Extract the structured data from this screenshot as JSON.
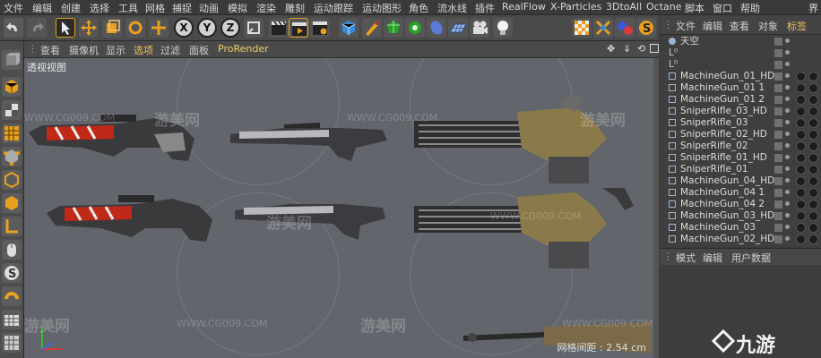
{
  "menubar": {
    "items": [
      "文件",
      "编辑",
      "创建",
      "选择",
      "工具",
      "网格",
      "捕捉",
      "动画",
      "模拟",
      "渲染",
      "雕刻",
      "运动跟踪",
      "运动图形",
      "角色",
      "流水线",
      "插件",
      "RealFlow",
      "X-Particles",
      "3DtoAll",
      "Octane",
      "脚本",
      "窗口",
      "帮助"
    ],
    "right_cut": "界"
  },
  "toolbar": {
    "axis_x": "X",
    "axis_y": "Y",
    "axis_z": "Z",
    "accent": "#e0a020"
  },
  "viewport_menu": {
    "items": [
      "查看",
      "摄像机",
      "显示",
      "选项",
      "过滤",
      "面板",
      "ProRender"
    ]
  },
  "viewport": {
    "label": "透视视图",
    "grid_readout": "网格间距 : 2.54 cm"
  },
  "object_manager": {
    "menu": [
      "文件",
      "编辑",
      "查看",
      "对象",
      "标签"
    ],
    "objects": [
      {
        "name": "天空",
        "icon": "sky-icon"
      },
      {
        "name": "",
        "icon": "null-icon"
      },
      {
        "name": "",
        "icon": "null-icon"
      },
      {
        "name": "MachineGun_01_HD",
        "icon": "mesh-icon"
      },
      {
        "name": "MachineGun_01 1",
        "icon": "mesh-icon"
      },
      {
        "name": "MachineGun_01 2",
        "icon": "mesh-icon"
      },
      {
        "name": "SniperRifle_03_HD",
        "icon": "mesh-icon"
      },
      {
        "name": "SniperRifle_03",
        "icon": "mesh-icon"
      },
      {
        "name": "SniperRifle_02_HD",
        "icon": "mesh-icon"
      },
      {
        "name": "SniperRifle_02",
        "icon": "mesh-icon"
      },
      {
        "name": "SniperRifle_01_HD",
        "icon": "mesh-icon"
      },
      {
        "name": "SniperRifle_01",
        "icon": "mesh-icon"
      },
      {
        "name": "MachineGun_04_HD",
        "icon": "mesh-icon"
      },
      {
        "name": "MachineGun_04 1",
        "icon": "mesh-icon"
      },
      {
        "name": "MachineGun_04 2",
        "icon": "mesh-icon"
      },
      {
        "name": "MachineGun_03_HD",
        "icon": "mesh-icon"
      },
      {
        "name": "MachineGun_03",
        "icon": "mesh-icon"
      },
      {
        "name": "MachineGun_02_HD",
        "icon": "mesh-icon"
      }
    ]
  },
  "attribute_manager": {
    "menu": [
      "模式",
      "编辑",
      "用户数据"
    ]
  },
  "watermarks": {
    "site": "WWW.CG009.COM",
    "brand": "游美网",
    "corner_logo": "九游"
  },
  "colors": {
    "viewport_bg": "#62666c",
    "panel_bg": "#3f3f3f",
    "menu_bg": "#3a3a3a",
    "active_tab": "#e5b04a"
  }
}
